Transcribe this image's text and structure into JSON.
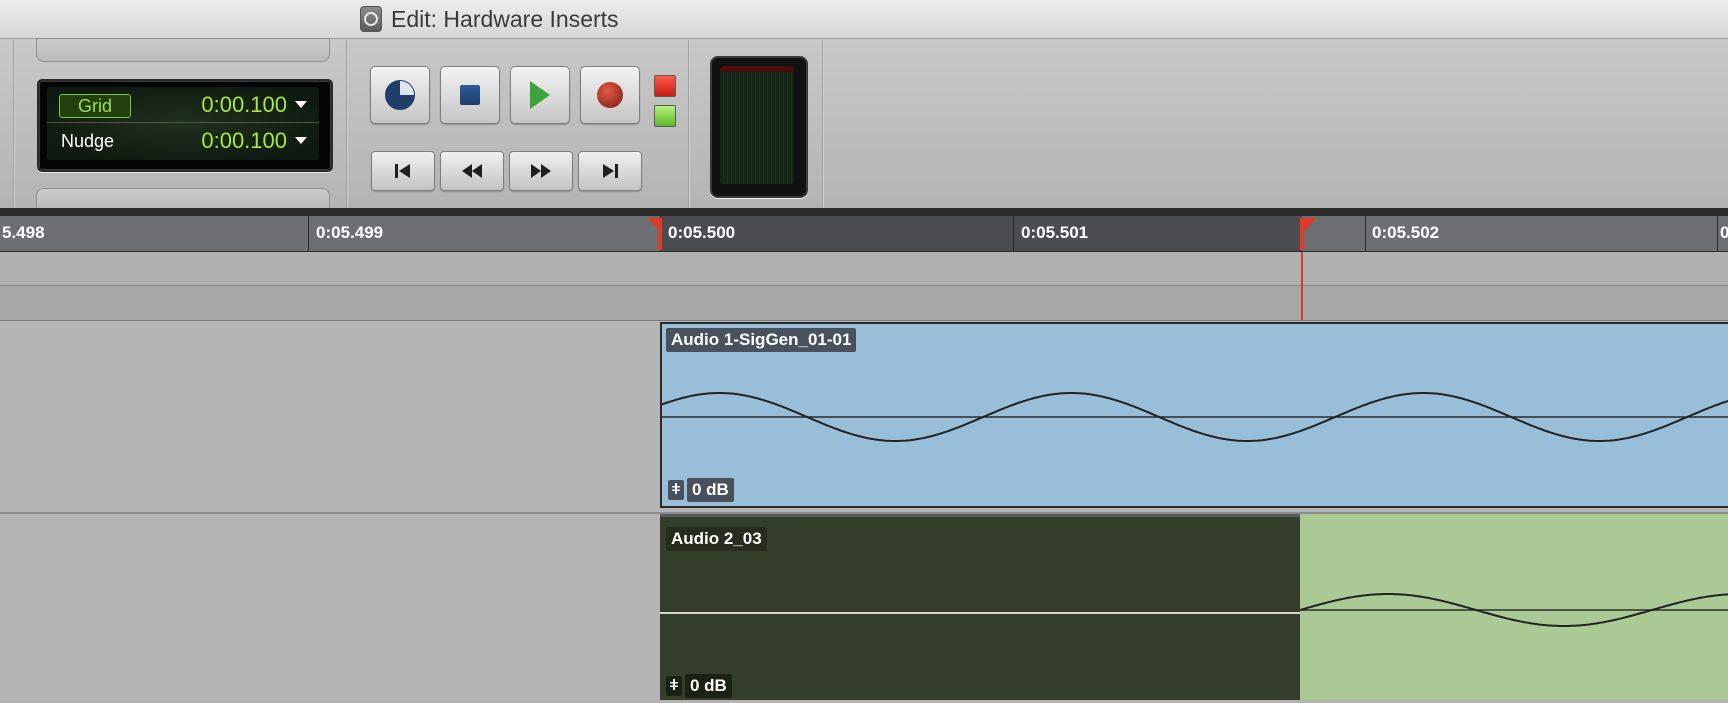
{
  "window": {
    "title": "Edit: Hardware Inserts",
    "title_icon": "pro-tools-icon"
  },
  "grid_nudge": {
    "grid_label": "Grid",
    "grid_value": "0:00.100",
    "nudge_label": "Nudge",
    "nudge_value": "0:00.100"
  },
  "transport": {
    "buttons": [
      "online-icon",
      "stop-icon",
      "play-icon",
      "record-icon"
    ],
    "nav_buttons": [
      "return-to-zero-icon",
      "rewind-icon",
      "fast-forward-icon",
      "go-to-end-icon"
    ],
    "status_leds": {
      "red": "#e23a24",
      "green": "#7fd84a"
    }
  },
  "ruler": {
    "labels": [
      "5.498",
      "0:05.499",
      "0:05.500",
      "0:05.501",
      "0:05.502",
      "0"
    ]
  },
  "tracks": [
    {
      "clip_name": "Audio 1-SigGen_01-01",
      "gain": "0 dB",
      "color": "#99bfd8"
    },
    {
      "clip_name": "Audio 2_03",
      "gain": "0 dB",
      "color": "#abc995"
    }
  ],
  "colors": {
    "selection_marker": "#e23a24",
    "lcd_text": "#a9e83a"
  }
}
